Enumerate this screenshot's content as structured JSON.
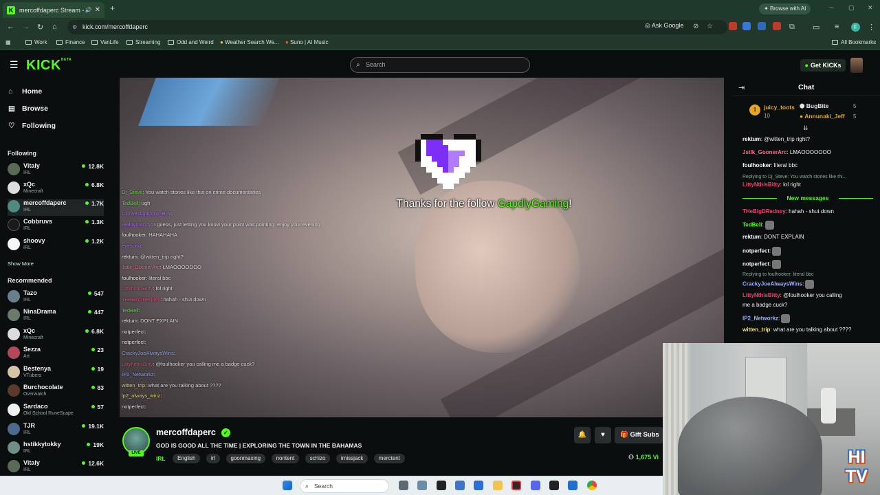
{
  "browser": {
    "tab_title": "mercoffdaperc Stream - W",
    "browse_ai": "Browse with AI",
    "url": "kick.com/mercoffdaperc",
    "ask_google": "Ask Google",
    "bookmarks": [
      "Work",
      "Finance",
      "VanLife",
      "Streaming",
      "Odd and Weird",
      "Weather Search We...",
      "Suno | AI Music"
    ],
    "all_bookmarks": "All Bookmarks",
    "profile_initial": "F"
  },
  "header": {
    "logo": "KICK",
    "search_placeholder": "Search",
    "get_kicks": "Get KICKs"
  },
  "sidebar": {
    "nav": [
      {
        "label": "Home",
        "icon": "home-icon"
      },
      {
        "label": "Browse",
        "icon": "browse-icon"
      },
      {
        "label": "Following",
        "icon": "heart-icon"
      }
    ],
    "following_title": "Following",
    "following": [
      {
        "name": "Vitaly",
        "category": "IRL",
        "viewers": "12.8K"
      },
      {
        "name": "xQc",
        "category": "Minecraft",
        "viewers": "6.8K"
      },
      {
        "name": "mercoffdaperc",
        "category": "IRL",
        "viewers": "1.7K"
      },
      {
        "name": "Cobbruvs",
        "category": "IRL",
        "viewers": "1.3K"
      },
      {
        "name": "shoovy",
        "category": "IRL",
        "viewers": "1.2K"
      }
    ],
    "show_more": "Show More",
    "recommended_title": "Recommended",
    "recommended": [
      {
        "name": "Tazo",
        "category": "IRL",
        "viewers": "547"
      },
      {
        "name": "NinaDrama",
        "category": "IRL",
        "viewers": "447"
      },
      {
        "name": "xQc",
        "category": "Minecraft",
        "viewers": "6.8K"
      },
      {
        "name": "Sezza",
        "category": "Art",
        "viewers": "23"
      },
      {
        "name": "Bestenya",
        "category": "VTubers",
        "viewers": "19"
      },
      {
        "name": "Burchocolate",
        "category": "Overwatch",
        "viewers": "83"
      },
      {
        "name": "Sardaco",
        "category": "Old School RuneScape",
        "viewers": "57"
      },
      {
        "name": "TJR",
        "category": "IRL",
        "viewers": "19.1K"
      },
      {
        "name": "hstikkytokky",
        "category": "IRL",
        "viewers": "19K"
      },
      {
        "name": "Vitaly",
        "category": "IRL",
        "viewers": "12.6K"
      }
    ]
  },
  "video": {
    "alert_prefix": "Thanks for the follow ",
    "alert_user": "GapdlyGaming",
    "alert_suffix": "!",
    "overlay_chat": [
      {
        "user": "Dj_Steve",
        "text": "You watch stories like this on crime documentaries",
        "color": "#53fc18"
      },
      {
        "user": "TedBell",
        "text": "ugh",
        "color": "#53fc18"
      },
      {
        "user": "Cxinvestigations_Boy",
        "text": "",
        "color": "#b06bff"
      },
      {
        "user": "realnymandy",
        "text": "I guess, just letting you know your point was pointing. enjoy your evening",
        "color": "#b06bff"
      },
      {
        "user": "foulhooker",
        "text": "HAHAHAHA",
        "color": "#ffffff"
      },
      {
        "user": "eyesonu",
        "text": "",
        "color": "#b06bff"
      },
      {
        "user": "rektum",
        "text": "@witten_trip right?",
        "color": "#ffffff"
      },
      {
        "user": "Jstlk_GoonerArc",
        "text": "LMAOOOOOOO",
        "color": "#ff6b8a"
      },
      {
        "user": "foulhooker",
        "text": "literal bbc",
        "color": "#ffffff"
      },
      {
        "user": "LittyNthisBitty",
        "text": "lol right",
        "color": "#ff3b6b"
      },
      {
        "user": "THeBigDRedney",
        "text": "hahah - shut down",
        "color": "#ff3b6b"
      },
      {
        "user": "TedBell",
        "text": "",
        "color": "#53fc18"
      },
      {
        "user": "rektum",
        "text": "DONT EXPLAIN",
        "color": "#ffffff"
      },
      {
        "user": "notperfect",
        "text": "",
        "color": "#ffffff"
      },
      {
        "user": "notperfect",
        "text": "",
        "color": "#ffffff"
      },
      {
        "user": "CrackyJoeAlwaysWins",
        "text": "",
        "color": "#9ab0ff"
      },
      {
        "user": "LittyNthisBitty",
        "text": "@foulhooker you calling me a badge cuck?",
        "color": "#ff3b6b"
      },
      {
        "user": "IP2_Networkz",
        "text": "",
        "color": "#9ab0ff"
      },
      {
        "user": "witten_trip",
        "text": "what are you talking about ????",
        "color": "#f5e56b"
      },
      {
        "user": "lp2_always_winz",
        "text": "",
        "color": "#f5e56b"
      },
      {
        "user": "notperfect",
        "text": "",
        "color": "#ffffff"
      }
    ]
  },
  "stream": {
    "streamer": "mercoffdaperc",
    "live": "LIVE",
    "title": "GOD IS GOOD ALL THE TIME | EXPLORING THE TOWN IN THE BAHAMAS",
    "category": "IRL",
    "tags": [
      "English",
      "irl",
      "goonmaxing",
      "nontent",
      "schizo",
      "imissjack",
      "merctent"
    ],
    "gift_subs": "Gift Subs",
    "viewers": "1,675 Vi"
  },
  "chat": {
    "title": "Chat",
    "leaders": [
      {
        "name": "juicy_toots",
        "count": "10",
        "color": "#e5a62a",
        "rank": "1"
      },
      {
        "name": "BugBite",
        "count": "5",
        "color": "#ffffff"
      },
      {
        "name": "Annunaki_Jeff",
        "count": "5",
        "color": "#e5a62a"
      }
    ],
    "new_messages": "New messages",
    "messages": [
      {
        "user": "rektum",
        "text": ": @witten_trip right?",
        "color": "#ffffff"
      },
      {
        "user": "Jstlk_GoonerArc",
        "text": ": LMAOOOOOOO",
        "color": "#ff6b8a"
      },
      {
        "user": "foulhooker",
        "text": ": literal bbc",
        "color": "#ffffff"
      },
      {
        "user": "LittyNthisBitty",
        "text": ": lol right",
        "color": "#ff3b6b"
      },
      {
        "user": "THeBigDRedney",
        "text": ": hahah - shut down",
        "color": "#ff3b6b"
      },
      {
        "user": "TedBell",
        "text": ":",
        "color": "#53fc18"
      },
      {
        "user": "rektum",
        "text": ": DONT EXPLAIN",
        "color": "#ffffff"
      },
      {
        "user": "notperfect",
        "text": ":",
        "color": "#ffffff"
      },
      {
        "user": "notperfect",
        "text": ":",
        "color": "#ffffff"
      },
      {
        "user": "CrackyJoeAlwaysWins",
        "text": ":",
        "color": "#9ab0ff"
      },
      {
        "user": "LittyNthisBitty",
        "text": ": @foulhooker you calling",
        "color": "#ff3b6b"
      },
      {
        "user": "",
        "text": "me a badge cuck?",
        "color": "#ffffff"
      },
      {
        "user": "IP2_Networkz",
        "text": ":",
        "color": "#9ab0ff"
      },
      {
        "user": "witten_trip",
        "text": ": what are you talking about ????",
        "color": "#f5e56b"
      }
    ],
    "reply1": "Replying to Dj_Steve: You watch stories like thi...",
    "reply2": "Replying to foulhooker: literal bbc"
  },
  "webcam": {
    "logo": "HI TV"
  },
  "taskbar": {
    "search": "Search"
  },
  "colors": {
    "accent": "#53fc18",
    "bg": "#0b0e0f"
  }
}
